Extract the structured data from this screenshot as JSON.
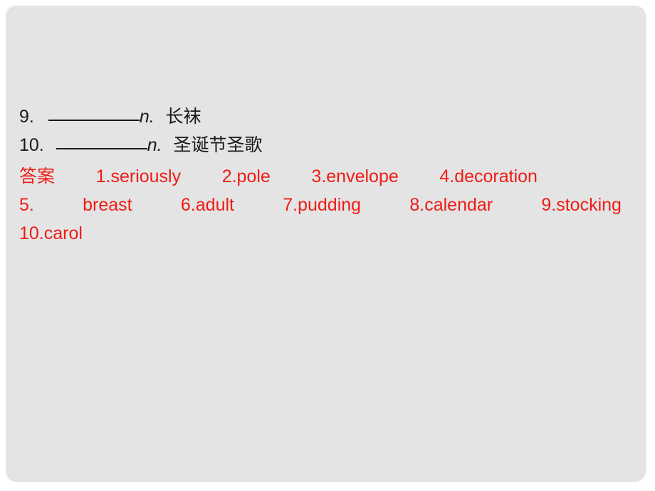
{
  "slide": {
    "background_color": "#e4e4e4",
    "page_color": "#ffffff",
    "answer_color": "#ee1c16",
    "text_color": "#1a1a1a"
  },
  "questions": [
    {
      "number": "9.",
      "blank": "_________",
      "pos": "n.",
      "chinese": "长袜"
    },
    {
      "number": "10.",
      "blank": "_________",
      "pos": "n.",
      "chinese": "圣诞节圣歌"
    }
  ],
  "answers": {
    "label": "答案",
    "row1": [
      "1.seriously",
      "2.pole",
      "3.envelope",
      "4.decoration"
    ],
    "row2": [
      "5.",
      "breast",
      "6.adult",
      "7.pudding",
      "8.calendar",
      "9.stocking"
    ],
    "row3": [
      "10.carol"
    ]
  }
}
